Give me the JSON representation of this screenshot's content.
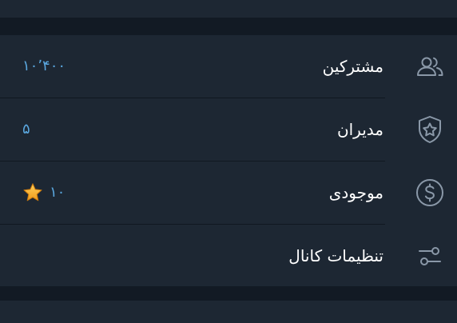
{
  "settings": {
    "items": [
      {
        "label": "مشترکین",
        "value": "۱۰٬۴۰۰",
        "icon": "users-icon"
      },
      {
        "label": "مدیران",
        "value": "۵",
        "icon": "shield-star-icon"
      },
      {
        "label": "موجودی",
        "value": "۱۰",
        "icon": "dollar-circle-icon",
        "value_icon": "star-icon"
      },
      {
        "label": "تنظیمات کانال",
        "value": "",
        "icon": "sliders-icon"
      }
    ]
  },
  "colors": {
    "background": "#0f1721",
    "card": "#1d2733",
    "text": "#ffffff",
    "accent": "#5aa7df",
    "icon": "#8a98a8",
    "star": "#f4b03a"
  }
}
